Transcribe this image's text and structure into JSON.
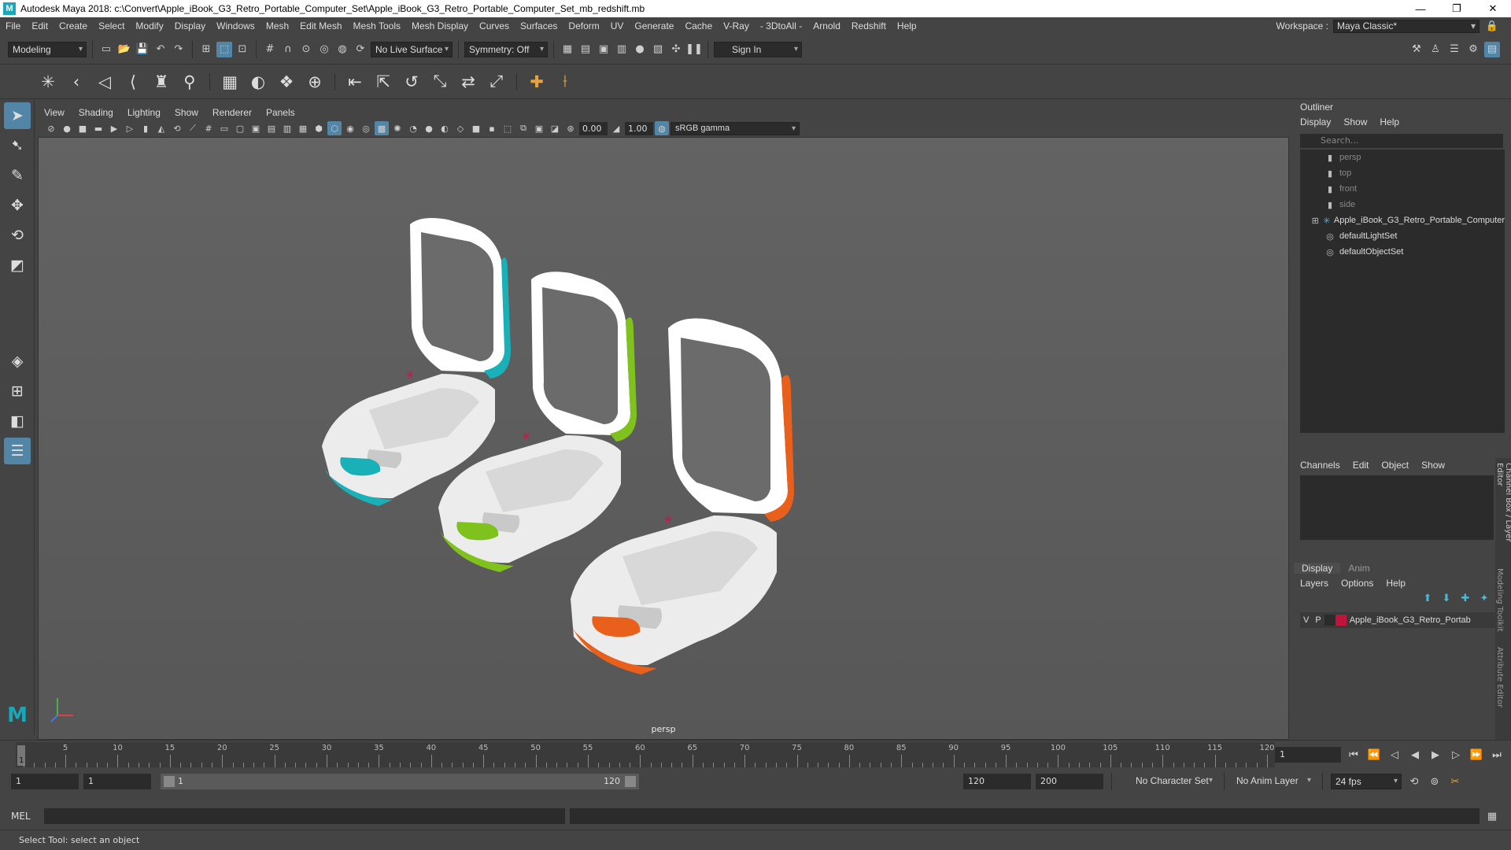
{
  "window": {
    "title": "Autodesk Maya 2018: c:\\Convert\\Apple_iBook_G3_Retro_Portable_Computer_Set\\Apple_iBook_G3_Retro_Portable_Computer_Set_mb_redshift.mb",
    "logo_letter": "M",
    "minimize": "—",
    "maximize": "❐",
    "close": "✕"
  },
  "menubar": {
    "items": [
      "File",
      "Edit",
      "Create",
      "Select",
      "Modify",
      "Display",
      "Windows",
      "Mesh",
      "Edit Mesh",
      "Mesh Tools",
      "Mesh Display",
      "Curves",
      "Surfaces",
      "Deform",
      "UV",
      "Generate",
      "Cache",
      "V-Ray",
      "- 3DtoAll -",
      "Arnold",
      "Redshift",
      "Help"
    ],
    "workspace_label": "Workspace :",
    "workspace_value": "Maya Classic*"
  },
  "statusline": {
    "mode": "Modeling",
    "live_surface": "No Live Surface",
    "symmetry": "Symmetry: Off",
    "sign_in": "Sign In"
  },
  "viewport": {
    "menus": [
      "View",
      "Shading",
      "Lighting",
      "Show",
      "Renderer",
      "Panels"
    ],
    "exposure": "0.00",
    "gamma": "1.00",
    "color_space": "sRGB gamma",
    "camera_label": "persp"
  },
  "outliner": {
    "title": "Outliner",
    "menus": [
      "Display",
      "Show",
      "Help"
    ],
    "search_placeholder": "Search...",
    "items": [
      {
        "label": "persp",
        "icon": "camera-icon"
      },
      {
        "label": "top",
        "icon": "camera-icon"
      },
      {
        "label": "front",
        "icon": "camera-icon"
      },
      {
        "label": "side",
        "icon": "camera-icon"
      },
      {
        "label": "Apple_iBook_G3_Retro_Portable_Computer",
        "icon": "group-icon"
      },
      {
        "label": "defaultLightSet",
        "icon": "set-icon"
      },
      {
        "label": "defaultObjectSet",
        "icon": "set-icon"
      }
    ]
  },
  "channelbox": {
    "menus": [
      "Channels",
      "Edit",
      "Object",
      "Show"
    ]
  },
  "layers": {
    "tabs": [
      "Display",
      "Anim"
    ],
    "menus": [
      "Layers",
      "Options",
      "Help"
    ],
    "row": {
      "v": "V",
      "p": "P",
      "name": "Apple_iBook_G3_Retro_Portab",
      "color": "#c0143c"
    }
  },
  "sidetabs": {
    "labels": [
      "Channel Box / Layer Editor",
      "Modeling Toolkit",
      "Attribute Editor"
    ]
  },
  "timeline": {
    "start": 1,
    "end": 120,
    "labels": [
      5,
      10,
      15,
      20,
      25,
      30,
      35,
      40,
      45,
      50,
      55,
      60,
      65,
      70,
      75,
      80,
      85,
      90,
      95,
      100,
      105,
      110,
      115,
      120
    ],
    "current_frame": "1",
    "current_marker": "1"
  },
  "range": {
    "start_field": "1",
    "start_inner": "1",
    "slider_start": "1",
    "slider_end": "120",
    "end_inner": "120",
    "end_field": "200",
    "character_set": "No Character Set",
    "anim_layer": "No Anim Layer",
    "fps": "24 fps"
  },
  "mel": {
    "label": "MEL"
  },
  "help_line": "Select Tool: select an object",
  "laptops": [
    {
      "color": "#1ab0b8"
    },
    {
      "color": "#7fc21e"
    },
    {
      "color": "#e8601c"
    }
  ]
}
